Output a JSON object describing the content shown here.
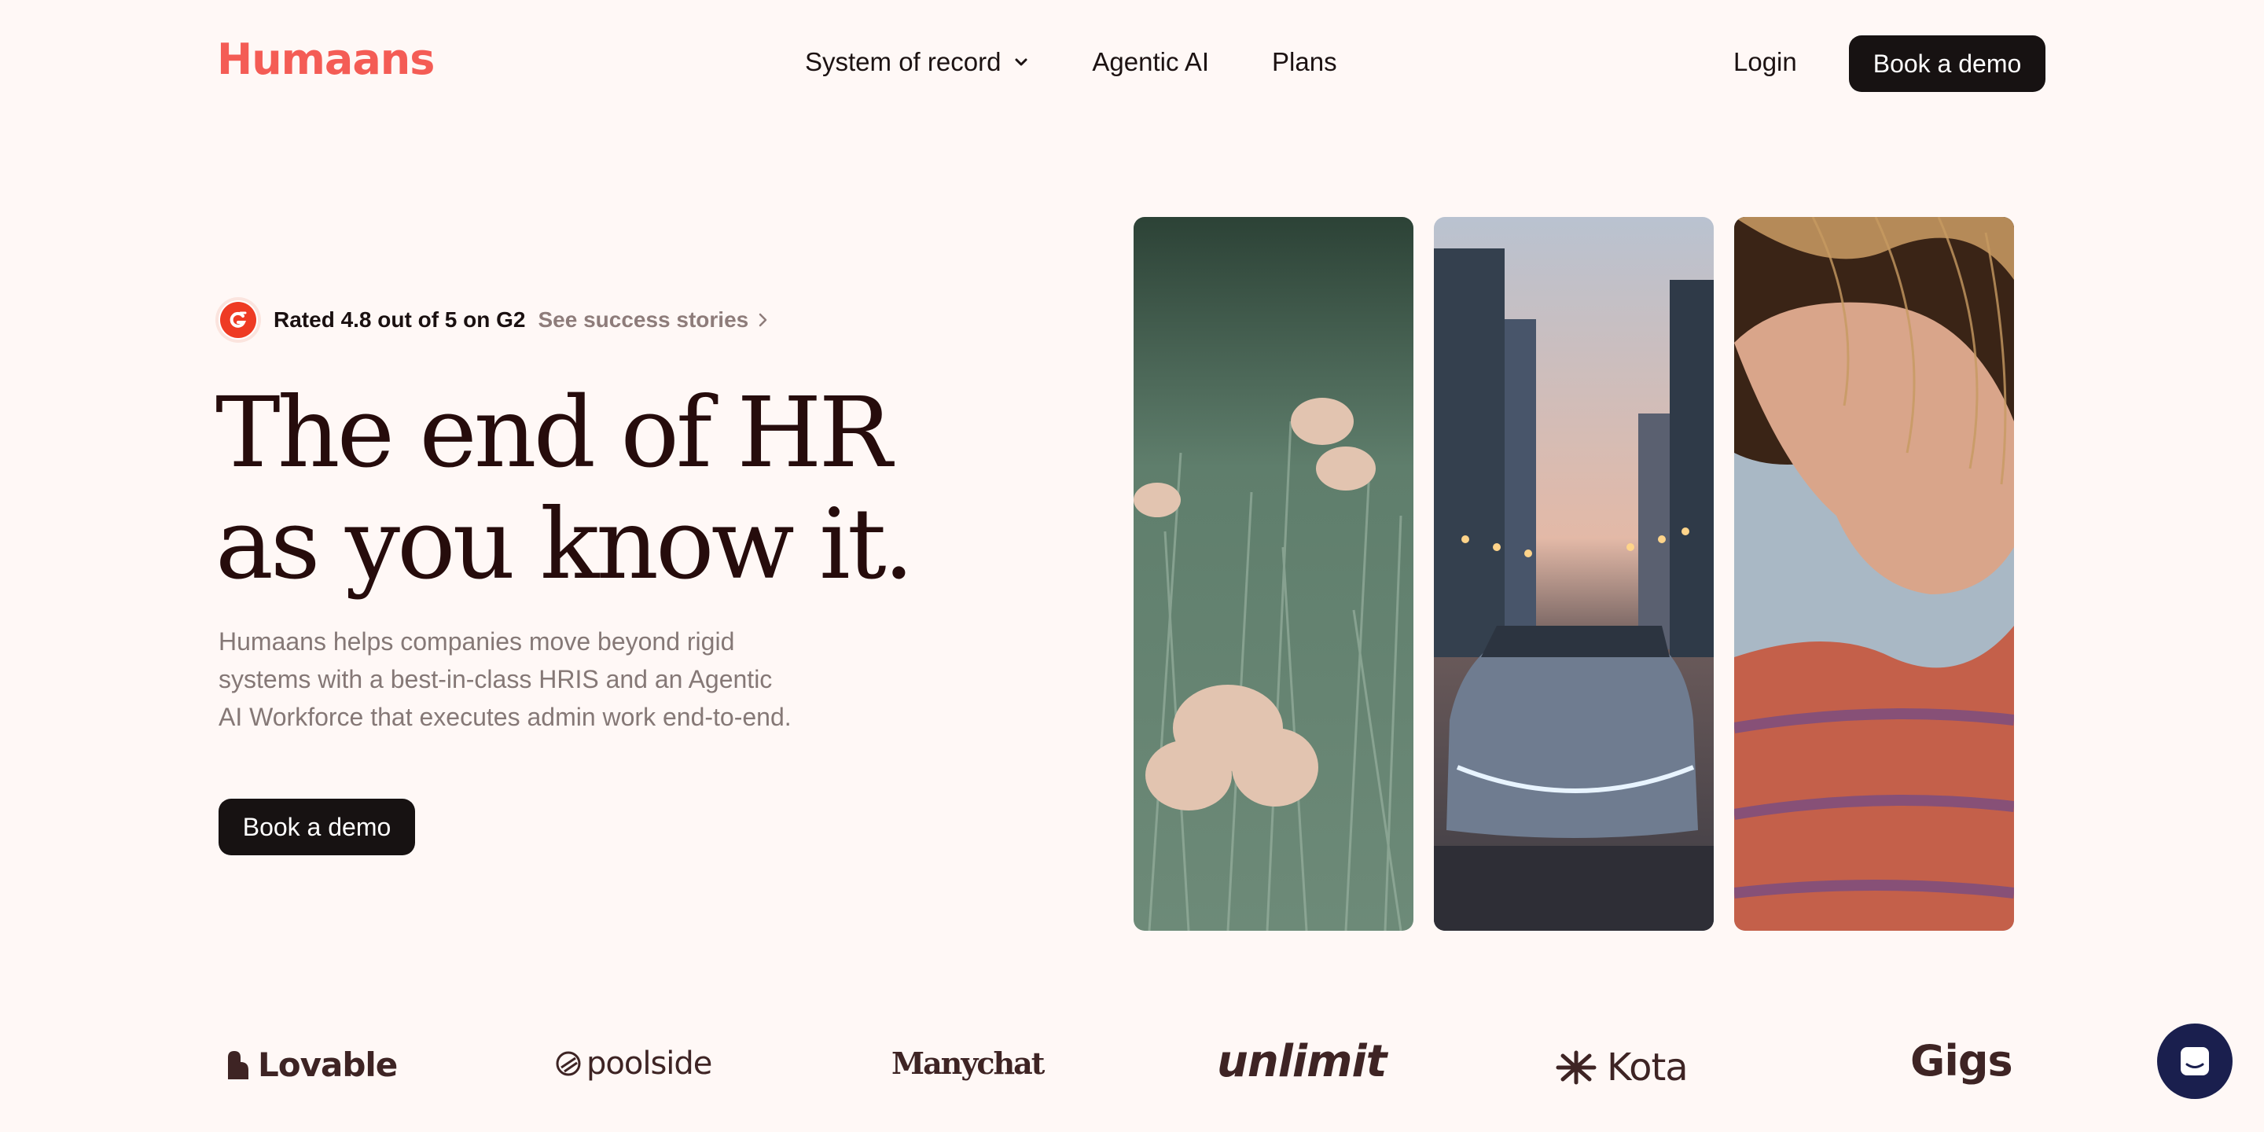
{
  "nav": {
    "logo": "Humaans",
    "links": [
      {
        "label": "System of record",
        "dropdown": true
      },
      {
        "label": "Agentic AI"
      },
      {
        "label": "Plans"
      }
    ],
    "login": "Login",
    "cta": "Book a demo"
  },
  "hero": {
    "rating_text": "Rated 4.8 out of 5 on G2",
    "rating_link": "See success stories",
    "headline_line1": "The end of HR",
    "headline_line2": "as you know it.",
    "sub_line1": "Humaans helps companies move beyond rigid",
    "sub_line2": "systems with a best-in-class HRIS and an Agentic",
    "sub_line3": "AI Workforce that executes admin work end-to-end.",
    "cta": "Book a demo"
  },
  "logos": [
    "Lovable",
    "poolside",
    "Manychat",
    "unlimit",
    "Kota",
    "Gigs"
  ],
  "colors": {
    "brand": "#f45c55",
    "background": "#fff8f6",
    "button": "#171212",
    "headline": "#260c0c",
    "chat": "#1a1f4e"
  },
  "icons": [
    "chevron-down-icon",
    "g2-icon",
    "chevron-right-icon",
    "chat-icon"
  ]
}
